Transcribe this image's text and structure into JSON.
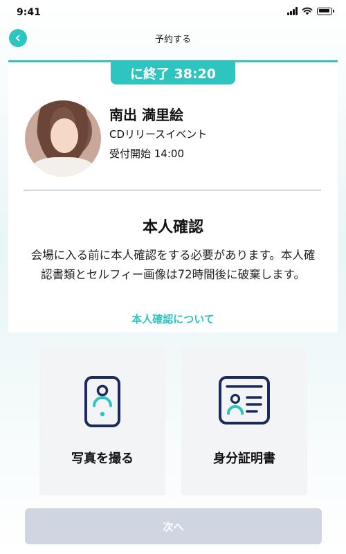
{
  "status": {
    "time": "9:41"
  },
  "header": {
    "title": "予約する"
  },
  "timer": {
    "text": "に終了 38:20"
  },
  "artist": {
    "name": "南出 満里絵",
    "event": "CDリリースイベント",
    "reception": "受付開始 14:00"
  },
  "verification": {
    "title": "本人確認",
    "description": "会場に入る前に本人確認をする必要があります。本人確認書類とセルフィー画像は72時間後に破棄します。",
    "link": "本人確認について"
  },
  "options": {
    "photo_label": "写真を撮る",
    "id_label": "身分証明書"
  },
  "footer": {
    "next_label": "次へ"
  },
  "colors": {
    "accent": "#2ec4c0",
    "navy": "#1b2a5a",
    "disabled": "#cfd6e1"
  }
}
